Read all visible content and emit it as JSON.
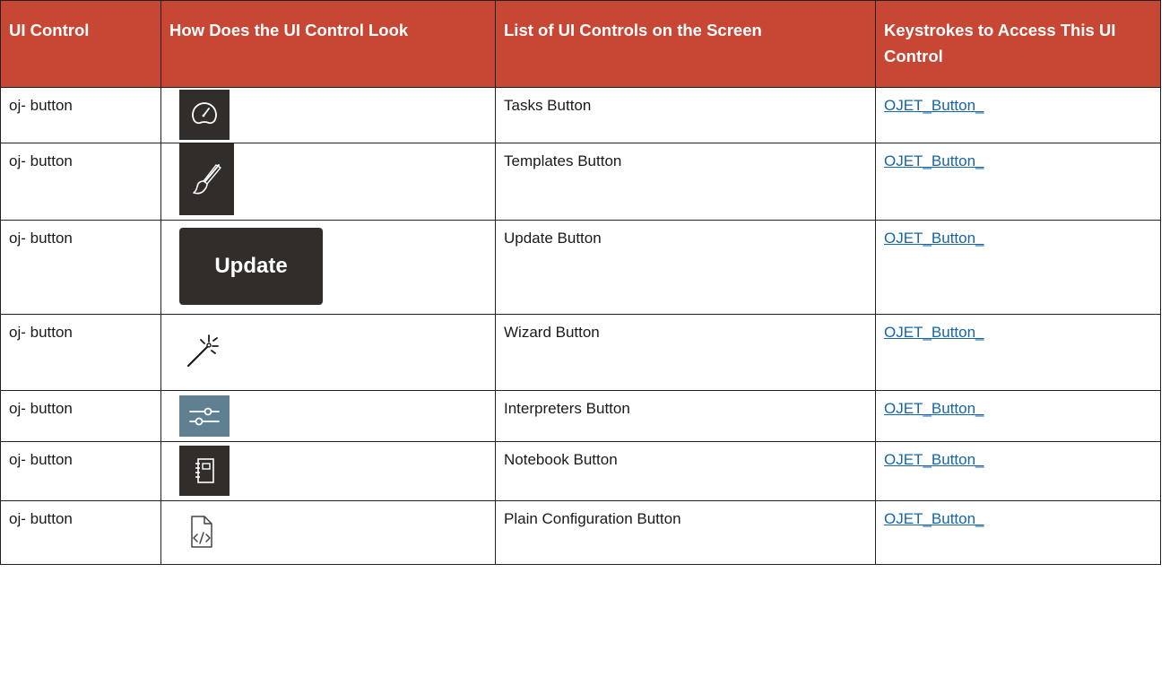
{
  "table": {
    "headers": [
      "UI Control",
      "How Does the UI Control Look",
      "List of UI Controls on the Screen",
      "Keystrokes to Access This UI Control"
    ],
    "rows": [
      {
        "control": "oj- button",
        "icon": "gauge-icon",
        "name": "Tasks Button",
        "link": "OJET_Button_"
      },
      {
        "control": "oj- button",
        "icon": "paintbrush-icon",
        "name": "Templates Button",
        "link": "OJET_Button_"
      },
      {
        "control": "oj- button",
        "icon": "update-button-image",
        "icon_label": "Update",
        "name": "Update Button",
        "link": "OJET_Button_"
      },
      {
        "control": "oj- button",
        "icon": "magic-wand-icon",
        "name": "Wizard Button",
        "link": "OJET_Button_"
      },
      {
        "control": "oj- button",
        "icon": "sliders-icon",
        "name": "Interpreters Button",
        "link": "OJET_Button_"
      },
      {
        "control": "oj- button",
        "icon": "notebook-icon",
        "name": "Notebook Button",
        "link": "OJET_Button_"
      },
      {
        "control": "oj- button",
        "icon": "code-file-icon",
        "name": "Plain Configuration Button",
        "link": "OJET_Button_"
      }
    ]
  },
  "colors": {
    "header_bg": "#c74634",
    "header_text": "#ffffff",
    "link": "#1565a8",
    "dark_icon_bg": "#312d2a",
    "slider_icon_bg": "#5f8090"
  }
}
